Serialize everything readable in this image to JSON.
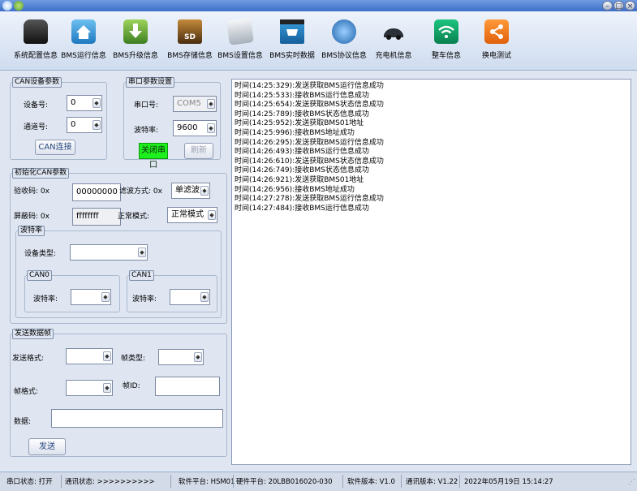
{
  "toolbar": {
    "items": [
      {
        "label": "系统配置信息",
        "icon": "car-icon",
        "color": "#2a2a2a"
      },
      {
        "label": "BMS运行信息",
        "icon": "home-icon",
        "color": "#2f8fd0"
      },
      {
        "label": "BMS升级信息",
        "icon": "download-icon",
        "color": "#4a8c2a"
      },
      {
        "label": "BMS存储信息",
        "icon": "sd-card-icon",
        "color": "#6b4a1e"
      },
      {
        "label": "BMS设置信息",
        "icon": "folder-icon",
        "color": "#9aa3ad"
      },
      {
        "label": "BMS实时数据",
        "icon": "amazon-cart-icon",
        "color": "#1f84c8"
      },
      {
        "label": "BMS协议信息",
        "icon": "globe-icon",
        "color": "#2e6fb8"
      },
      {
        "label": "充电机信息",
        "icon": "sports-car-icon",
        "color": "#2b2f36"
      },
      {
        "label": "整车信息",
        "icon": "wifi-icon",
        "color": "#10a56a"
      },
      {
        "label": "换电测试",
        "icon": "share-icon",
        "color": "#f07a1c"
      }
    ]
  },
  "can_device": {
    "legend": "CAN设备参数",
    "device_label": "设备号:",
    "device_value": "0",
    "channel_label": "通道号:",
    "channel_value": "0",
    "connect_button": "CAN连接"
  },
  "serial": {
    "legend": "串口参数设置",
    "port_label": "串口号:",
    "port_value": "COM5",
    "baud_label": "波特率:",
    "baud_value": "9600",
    "close_button": "关闭串口",
    "close_button_color": "#1ef01e",
    "refresh_button": "刷新"
  },
  "init_can": {
    "legend": "初始化CAN参数",
    "code_label": "验收码: 0x",
    "code_value": "00000000",
    "filter_label": "滤波方式: 0x",
    "filter_value": "单滤波",
    "mask_label": "屏蔽码: 0x",
    "mask_value": "ffffffff",
    "mode_label": "正常模式:",
    "mode_value": "正常模式",
    "baud_group": {
      "legend": "波特率",
      "device_type_label": "设备类型:",
      "device_type_value": "",
      "can0": {
        "legend": "CAN0",
        "label": "波特率:",
        "value": ""
      },
      "can1": {
        "legend": "CAN1",
        "label": "波特率:",
        "value": ""
      }
    }
  },
  "send": {
    "legend": "发送数据帧",
    "format_label": "发送格式:",
    "format_value": "",
    "frame_type_label": "帧类型:",
    "frame_type_value": "",
    "frame_format_label": "帧格式:",
    "frame_format_value": "",
    "frame_id_label": "帧ID:",
    "frame_id_value": "",
    "data_label": "数据:",
    "data_value": "",
    "send_button": "发送"
  },
  "log": {
    "lines": [
      "时间(14:25:329):发送获取BMS运行信息成功",
      "时间(14:25:533):接收BMS运行信息成功",
      "时间(14:25:654):发送获取BMS状态信息成功",
      "时间(14:25:789):接收BMS状态信息成功",
      "时间(14:25:952):发送获取BMS01地址",
      "时间(14:25:996):接收BMS地址成功",
      "时间(14:26:295):发送获取BMS运行信息成功",
      "时间(14:26:493):接收BMS运行信息成功",
      "时间(14:26:610):发送获取BMS状态信息成功",
      "时间(14:26:749):接收BMS状态信息成功",
      "时间(14:26:921):发送获取BMS01地址",
      "时间(14:26:956):接收BMS地址成功",
      "时间(14:27:278):发送获取BMS运行信息成功",
      "时间(14:27:484):接收BMS运行信息成功"
    ]
  },
  "status": {
    "serial_state": "串口状态: 打开",
    "comm_state": "通讯状态: >>>>>>>>>>",
    "software_platform": "软件平台: HSM01",
    "hardware_platform": "硬件平台: 20LBB016020-030",
    "software_version": "软件版本: V1.0",
    "comm_version": "通讯版本: V1.22",
    "datetime": "2022年05月19日 15:14:27"
  }
}
